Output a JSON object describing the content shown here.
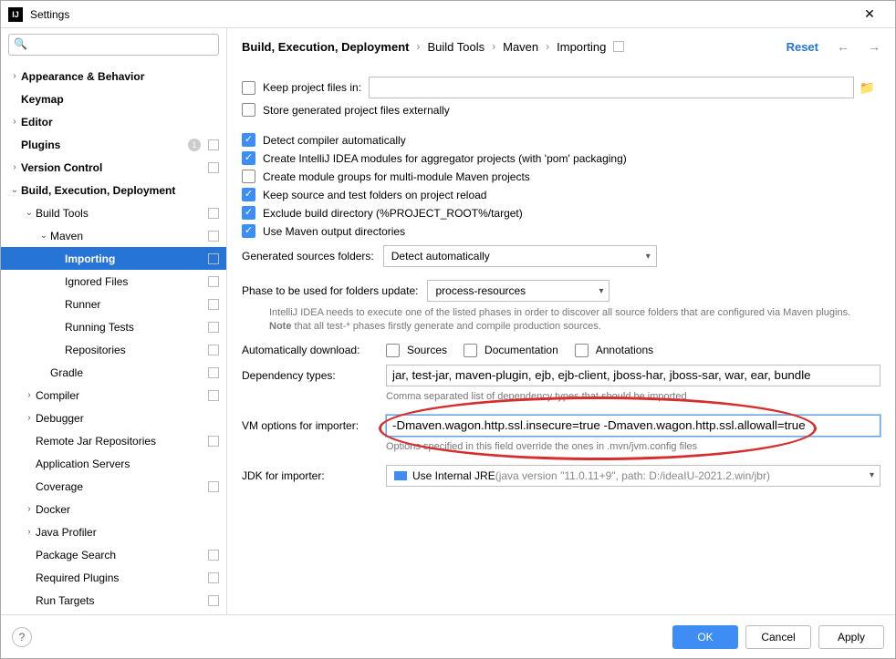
{
  "window": {
    "title": "Settings"
  },
  "breadcrumb": {
    "items": [
      "Build, Execution, Deployment",
      "Build Tools",
      "Maven",
      "Importing"
    ],
    "reset": "Reset"
  },
  "sidebar": {
    "search_placeholder": "",
    "items": [
      {
        "label": "Appearance & Behavior",
        "indent": 0,
        "chev": "›",
        "bold": true
      },
      {
        "label": "Keymap",
        "indent": 0,
        "chev": "",
        "bold": true
      },
      {
        "label": "Editor",
        "indent": 0,
        "chev": "›",
        "bold": true
      },
      {
        "label": "Plugins",
        "indent": 0,
        "chev": "",
        "bold": true,
        "badge": "1",
        "marker": true
      },
      {
        "label": "Version Control",
        "indent": 0,
        "chev": "›",
        "bold": true,
        "marker": true
      },
      {
        "label": "Build, Execution, Deployment",
        "indent": 0,
        "chev": "⌄",
        "bold": true
      },
      {
        "label": "Build Tools",
        "indent": 1,
        "chev": "⌄",
        "marker": true
      },
      {
        "label": "Maven",
        "indent": 2,
        "chev": "⌄",
        "marker": true
      },
      {
        "label": "Importing",
        "indent": 3,
        "chev": "",
        "selected": true,
        "marker": true
      },
      {
        "label": "Ignored Files",
        "indent": 3,
        "chev": "",
        "marker": true
      },
      {
        "label": "Runner",
        "indent": 3,
        "chev": "",
        "marker": true
      },
      {
        "label": "Running Tests",
        "indent": 3,
        "chev": "",
        "marker": true
      },
      {
        "label": "Repositories",
        "indent": 3,
        "chev": "",
        "marker": true
      },
      {
        "label": "Gradle",
        "indent": 2,
        "chev": "",
        "marker": true
      },
      {
        "label": "Compiler",
        "indent": 1,
        "chev": "›",
        "marker": true
      },
      {
        "label": "Debugger",
        "indent": 1,
        "chev": "›"
      },
      {
        "label": "Remote Jar Repositories",
        "indent": 1,
        "chev": "",
        "marker": true
      },
      {
        "label": "Application Servers",
        "indent": 1,
        "chev": ""
      },
      {
        "label": "Coverage",
        "indent": 1,
        "chev": "",
        "marker": true
      },
      {
        "label": "Docker",
        "indent": 1,
        "chev": "›"
      },
      {
        "label": "Java Profiler",
        "indent": 1,
        "chev": "›"
      },
      {
        "label": "Package Search",
        "indent": 1,
        "chev": "",
        "marker": true
      },
      {
        "label": "Required Plugins",
        "indent": 1,
        "chev": "",
        "marker": true
      },
      {
        "label": "Run Targets",
        "indent": 1,
        "chev": "",
        "marker": true
      }
    ]
  },
  "form": {
    "keep_project_files": {
      "label": "Keep project files in:",
      "checked": false,
      "value": ""
    },
    "store_external": {
      "label": "Store generated project files externally",
      "checked": false
    },
    "detect_compiler": {
      "label": "Detect compiler automatically",
      "checked": true
    },
    "create_modules": {
      "label": "Create IntelliJ IDEA modules for aggregator projects (with 'pom' packaging)",
      "checked": true
    },
    "create_groups": {
      "label": "Create module groups for multi-module Maven projects",
      "checked": false
    },
    "keep_source": {
      "label": "Keep source and test folders on project reload",
      "checked": true
    },
    "exclude_build": {
      "label": "Exclude build directory (%PROJECT_ROOT%/target)",
      "checked": true
    },
    "use_maven_output": {
      "label": "Use Maven output directories",
      "checked": true
    },
    "generated_sources": {
      "label": "Generated sources folders:",
      "value": "Detect automatically"
    },
    "phase": {
      "label": "Phase to be used for folders update:",
      "value": "process-resources",
      "hint_prefix": "IntelliJ IDEA needs to execute one of the listed phases in order to discover all source folders that are configured via Maven plugins.",
      "hint_note": "Note",
      "hint_rest": " that all test-* phases firstly generate and compile production sources."
    },
    "auto_download": {
      "label": "Automatically download:",
      "sources": {
        "label": "Sources",
        "checked": false
      },
      "docs": {
        "label": "Documentation",
        "checked": false
      },
      "annotations": {
        "label": "Annotations",
        "checked": false
      }
    },
    "dep_types": {
      "label": "Dependency types:",
      "value": "jar, test-jar, maven-plugin, ejb, ejb-client, jboss-har, jboss-sar, war, ear, bundle",
      "hint": "Comma separated list of dependency types that should be imported"
    },
    "vm_options": {
      "label": "VM options for importer:",
      "value": "-Dmaven.wagon.http.ssl.insecure=true -Dmaven.wagon.http.ssl.allowall=true",
      "hint": "Options specified in this field override the ones in .mvn/jvm.config files"
    },
    "jdk": {
      "label": "JDK for importer:",
      "value": "Use Internal JRE",
      "detail": " (java version \"11.0.11+9\", path: D:/ideaIU-2021.2.win/jbr)"
    }
  },
  "footer": {
    "ok": "OK",
    "cancel": "Cancel",
    "apply": "Apply"
  }
}
